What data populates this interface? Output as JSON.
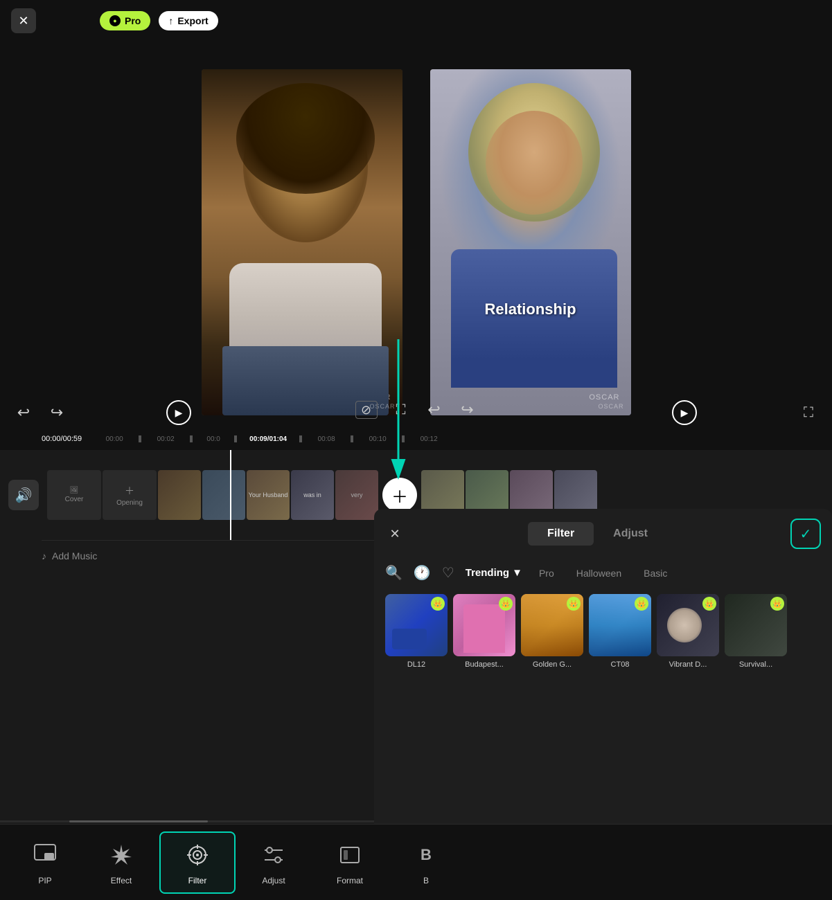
{
  "topbar": {
    "close_label": "✕",
    "pro_label": "Pro",
    "export_label": "Export",
    "pro_icon": "●"
  },
  "preview": {
    "left_video": {
      "watermark": "OSCAR"
    },
    "right_video": {
      "text": "Relationship",
      "watermark": "OSCAR"
    }
  },
  "controls": {
    "undo": "↩",
    "redo": "↪",
    "play": "▶",
    "fullscreen": "⛶",
    "no_caption": "⊘"
  },
  "timeline": {
    "current_time": "00:00/00:59",
    "markers": [
      "00:00",
      "00:02",
      "00:0",
      "00:09/01:04",
      "00:08",
      "00:10",
      "00:12"
    ],
    "add_music": "Add Music"
  },
  "filter_panel": {
    "close": "✕",
    "tabs": [
      {
        "label": "Filter",
        "active": true
      },
      {
        "label": "Adjust",
        "active": false
      }
    ],
    "check": "✓",
    "categories": [
      "Trending",
      "Pro",
      "Halloween",
      "Basic"
    ],
    "trending_arrow": "▼",
    "filters": [
      {
        "id": "dl12",
        "name": "DL12",
        "has_crown": true,
        "class": "ft-dl12"
      },
      {
        "id": "budapest",
        "name": "Budapest...",
        "has_crown": true,
        "class": "ft-budapest"
      },
      {
        "id": "golden",
        "name": "Golden G...",
        "has_crown": true,
        "class": "ft-golden"
      },
      {
        "id": "ct08",
        "name": "CT08",
        "has_crown": true,
        "class": "ft-ct08"
      },
      {
        "id": "vibrant",
        "name": "Vibrant D...",
        "has_crown": true,
        "class": "ft-vibrant"
      },
      {
        "id": "survival",
        "name": "Survival...",
        "has_crown": true,
        "class": "ft-survival"
      }
    ]
  },
  "bottom_toolbar": {
    "tools": [
      {
        "id": "pip",
        "icon": "🖼",
        "label": "PIP",
        "active": false
      },
      {
        "id": "effect",
        "icon": "✦",
        "label": "Effect",
        "active": false
      },
      {
        "id": "filter",
        "icon": "◎",
        "label": "Filter",
        "active": true
      },
      {
        "id": "adjust",
        "icon": "⚙",
        "label": "Adjust",
        "active": false
      },
      {
        "id": "format",
        "icon": "▭",
        "label": "Format",
        "active": false
      },
      {
        "id": "b",
        "icon": "B",
        "label": "B",
        "active": false
      }
    ]
  },
  "arrow": {
    "label": "arrow pointing to filter panel"
  }
}
